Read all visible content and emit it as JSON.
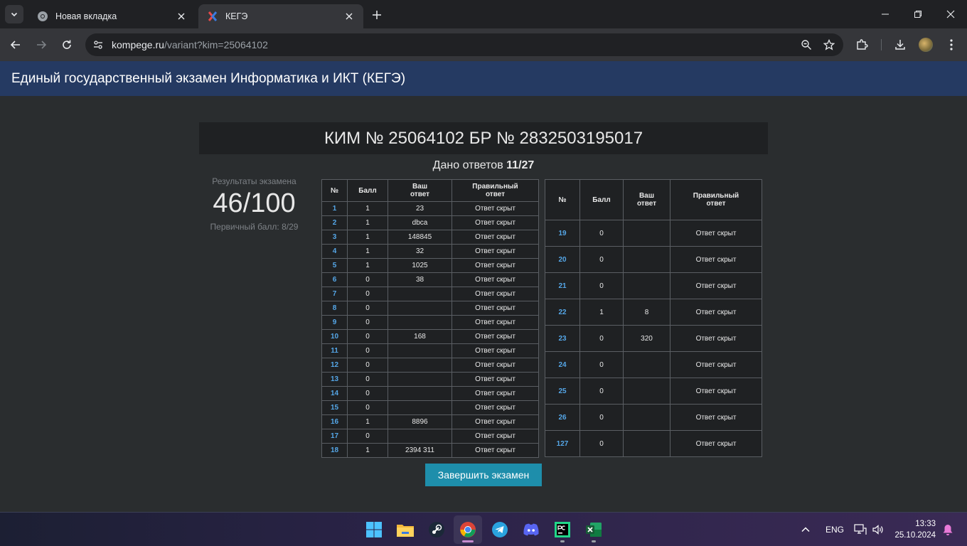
{
  "browser": {
    "tabs": [
      {
        "title": "Новая вкладка",
        "active": false
      },
      {
        "title": "КЕГЭ",
        "active": true
      }
    ],
    "url_host": "kompege.ru",
    "url_path": "/variant?kim=25064102"
  },
  "site": {
    "header_title": "Единый государственный экзамен Информатика и ИКТ (КЕГЭ)"
  },
  "exam": {
    "kim_title": "КИМ № 25064102 БР № 2832503195017",
    "answers_label": "Дано ответов",
    "answers_count": "11/27",
    "results_caption": "Результаты экзамена",
    "score": "46/100",
    "primary_score": "Первичный балл: 8/29",
    "finish_button": "Завершить экзамен"
  },
  "table_headers": {
    "num": "№",
    "score": "Балл",
    "your_answer_1": "Ваш",
    "your_answer_2": "ответ",
    "correct_answer_1": "Правильный",
    "correct_answer_2": "ответ"
  },
  "left_rows": [
    {
      "num": "1",
      "score": "1",
      "answer": "23",
      "correct": "Ответ скрыт"
    },
    {
      "num": "2",
      "score": "1",
      "answer": "dbca",
      "correct": "Ответ скрыт"
    },
    {
      "num": "3",
      "score": "1",
      "answer": "148845",
      "correct": "Ответ скрыт"
    },
    {
      "num": "4",
      "score": "1",
      "answer": "32",
      "correct": "Ответ скрыт"
    },
    {
      "num": "5",
      "score": "1",
      "answer": "1025",
      "correct": "Ответ скрыт"
    },
    {
      "num": "6",
      "score": "0",
      "answer": "38",
      "correct": "Ответ скрыт"
    },
    {
      "num": "7",
      "score": "0",
      "answer": "",
      "correct": "Ответ скрыт"
    },
    {
      "num": "8",
      "score": "0",
      "answer": "",
      "correct": "Ответ скрыт"
    },
    {
      "num": "9",
      "score": "0",
      "answer": "",
      "correct": "Ответ скрыт"
    },
    {
      "num": "10",
      "score": "0",
      "answer": "168",
      "correct": "Ответ скрыт"
    },
    {
      "num": "11",
      "score": "0",
      "answer": "",
      "correct": "Ответ скрыт"
    },
    {
      "num": "12",
      "score": "0",
      "answer": "",
      "correct": "Ответ скрыт"
    },
    {
      "num": "13",
      "score": "0",
      "answer": "",
      "correct": "Ответ скрыт"
    },
    {
      "num": "14",
      "score": "0",
      "answer": "",
      "correct": "Ответ скрыт"
    },
    {
      "num": "15",
      "score": "0",
      "answer": "",
      "correct": "Ответ скрыт"
    },
    {
      "num": "16",
      "score": "1",
      "answer": "8896",
      "correct": "Ответ скрыт"
    },
    {
      "num": "17",
      "score": "0",
      "answer": "",
      "correct": "Ответ скрыт"
    },
    {
      "num": "18",
      "score": "1",
      "answer": "2394 311",
      "correct": "Ответ скрыт"
    }
  ],
  "right_rows": [
    {
      "num": "19",
      "score": "0",
      "answer": "",
      "correct": "Ответ скрыт"
    },
    {
      "num": "20",
      "score": "0",
      "answer": "",
      "correct": "Ответ скрыт"
    },
    {
      "num": "21",
      "score": "0",
      "answer": "",
      "correct": "Ответ скрыт"
    },
    {
      "num": "22",
      "score": "1",
      "answer": "8",
      "correct": "Ответ скрыт"
    },
    {
      "num": "23",
      "score": "0",
      "answer": "320",
      "correct": "Ответ скрыт"
    },
    {
      "num": "24",
      "score": "0",
      "answer": "",
      "correct": "Ответ скрыт"
    },
    {
      "num": "25",
      "score": "0",
      "answer": "",
      "correct": "Ответ скрыт"
    },
    {
      "num": "26",
      "score": "0",
      "answer": "",
      "correct": "Ответ скрыт"
    },
    {
      "num": "127",
      "score": "0",
      "answer": "",
      "correct": "Ответ скрыт"
    }
  ],
  "taskbar": {
    "apps": [
      "start-icon",
      "file-explorer-icon",
      "steam-icon",
      "chrome-icon",
      "telegram-icon",
      "discord-icon",
      "pycharm-icon",
      "excel-icon"
    ],
    "language": "ENG",
    "time": "13:33",
    "date": "25.10.2024"
  },
  "colors": {
    "header_bg": "#253a62",
    "page_bg": "#2a2d2f",
    "accent_button": "#1e8eab",
    "link_num": "#55a7e8"
  }
}
